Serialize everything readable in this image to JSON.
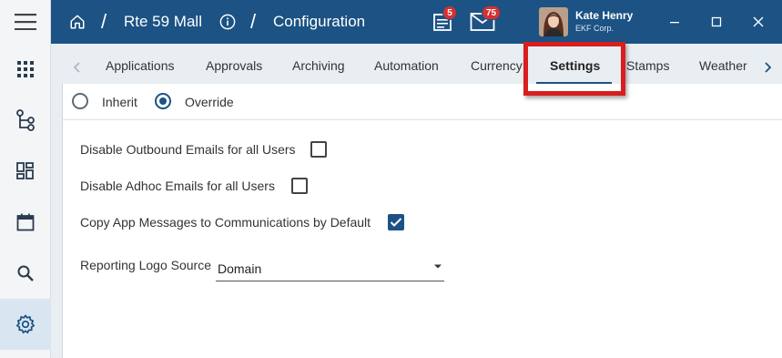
{
  "header": {
    "breadcrumb_site": "Rte 59 Mall",
    "breadcrumb_page": "Configuration",
    "tasks_badge": "5",
    "mail_badge": "75",
    "user_name": "Kate Henry",
    "user_org": "EKF Corp.",
    "bg_color": "#1c5284"
  },
  "sidebar": {
    "items": [
      {
        "icon": "apps-grid-icon"
      },
      {
        "icon": "workflow-icon"
      },
      {
        "icon": "dashboard-icon"
      },
      {
        "icon": "calendar-icon"
      },
      {
        "icon": "search-icon"
      },
      {
        "icon": "settings-gear-icon",
        "active": true
      }
    ]
  },
  "tabs": {
    "items": [
      "Applications",
      "Approvals",
      "Archiving",
      "Automation",
      "Currency",
      "Settings",
      "Stamps",
      "Weather"
    ],
    "active": "Settings"
  },
  "mode": {
    "inherit_label": "Inherit",
    "override_label": "Override",
    "selected": "Override"
  },
  "settings": {
    "disable_outbound_label": "Disable Outbound Emails for all Users",
    "disable_outbound_checked": false,
    "disable_adhoc_label": "Disable Adhoc Emails for all Users",
    "disable_adhoc_checked": false,
    "copy_messages_label": "Copy App Messages to Communications by Default",
    "copy_messages_checked": true,
    "logo_source_label": "Reporting Logo Source",
    "logo_source_value": "Domain"
  },
  "colors": {
    "accent": "#1c5284",
    "highlight": "#d81e1e",
    "badge": "#d63031"
  }
}
